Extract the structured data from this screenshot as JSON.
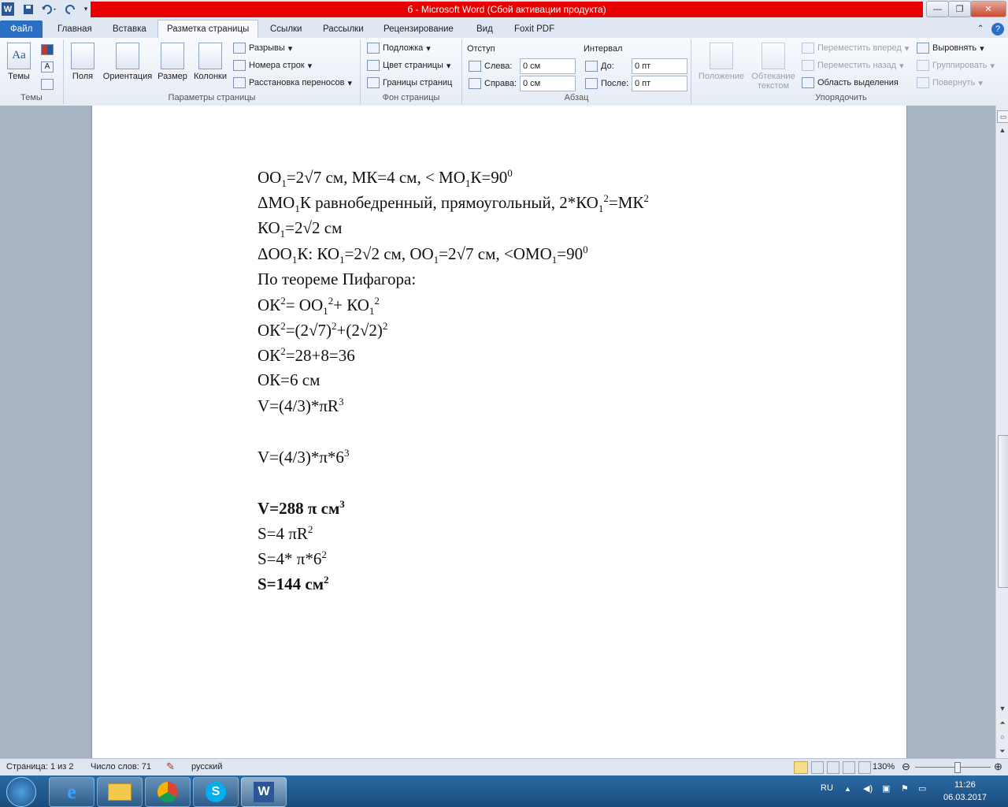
{
  "window": {
    "title": "б - Microsoft Word (Сбой активации продукта)",
    "word_icon": "W",
    "save_icon": "save-icon",
    "undo_icon": "undo-icon",
    "redo_icon": "redo-icon",
    "minimize": "—",
    "restore": "❐",
    "close": "✕"
  },
  "tabs": {
    "file": "Файл",
    "items": [
      "Главная",
      "Вставка",
      "Разметка страницы",
      "Ссылки",
      "Рассылки",
      "Рецензирование",
      "Вид",
      "Foxit PDF"
    ],
    "active_index": 2
  },
  "ribbon": {
    "themes": {
      "label": "Темы",
      "group": "Темы"
    },
    "page_setup": {
      "group": "Параметры страницы",
      "fields": "Поля",
      "orientation": "Ориентация",
      "size": "Размер",
      "columns": "Колонки",
      "breaks": "Разрывы",
      "line_numbers": "Номера строк",
      "hyphenation": "Расстановка переносов"
    },
    "page_background": {
      "group": "Фон страницы",
      "watermark": "Подложка",
      "page_color": "Цвет страницы",
      "page_borders": "Границы страниц"
    },
    "paragraph": {
      "group": "Абзац",
      "indent": "Отступ",
      "spacing": "Интервал",
      "left_label": "Слева:",
      "left_value": "0 см",
      "right_label": "Справа:",
      "right_value": "0 см",
      "before_label": "До:",
      "before_value": "0 пт",
      "after_label": "После:",
      "after_value": "0 пт"
    },
    "arrange": {
      "group": "Упорядочить",
      "position": "Положение",
      "wrap1": "Обтекание",
      "wrap2": "текстом",
      "bring_forward": "Переместить вперед",
      "send_backward": "Переместить назад",
      "selection_pane": "Область выделения",
      "align": "Выровнять",
      "group_btn": "Группировать",
      "rotate": "Повернуть"
    }
  },
  "document": {
    "lines": [
      {
        "parts": [
          [
            "OO"
          ],
          [
            "1",
            "sub"
          ],
          [
            "=2√7 см, МК=4 см, < МО"
          ],
          [
            "1",
            "sub"
          ],
          [
            "К=90"
          ],
          [
            "0",
            "sup"
          ]
        ]
      },
      {
        "parts": [
          [
            "ΔМО"
          ],
          [
            "1",
            "sub"
          ],
          [
            "К равнобедренный, прямоугольный, 2*КО"
          ],
          [
            "1",
            "sub"
          ],
          [
            "2",
            "sup"
          ],
          [
            "=МК"
          ],
          [
            "2",
            "sup"
          ]
        ]
      },
      {
        "parts": [
          [
            "КО"
          ],
          [
            "1",
            "sub"
          ],
          [
            "=2√2 см"
          ]
        ]
      },
      {
        "parts": [
          [
            "ΔОО"
          ],
          [
            "1",
            "sub"
          ],
          [
            "К: КО"
          ],
          [
            "1",
            "sub"
          ],
          [
            "=2√2 см, ОО"
          ],
          [
            "1",
            "sub"
          ],
          [
            "=2√7 см, <ОМО"
          ],
          [
            "1",
            "sub"
          ],
          [
            "=90"
          ],
          [
            "0",
            "sup"
          ]
        ]
      },
      {
        "parts": [
          [
            "По теореме Пифагора:"
          ]
        ]
      },
      {
        "parts": [
          [
            "ОК"
          ],
          [
            "2",
            "sup"
          ],
          [
            "= ОО"
          ],
          [
            "1",
            "sub"
          ],
          [
            "2",
            "sup"
          ],
          [
            "+ КО"
          ],
          [
            "1",
            "sub"
          ],
          [
            "2",
            "sup"
          ]
        ]
      },
      {
        "parts": [
          [
            "ОК"
          ],
          [
            "2",
            "sup"
          ],
          [
            "=(2√7)"
          ],
          [
            "2",
            "sup"
          ],
          [
            "+(2√2)"
          ],
          [
            "2",
            "sup"
          ]
        ]
      },
      {
        "parts": [
          [
            "ОК"
          ],
          [
            "2",
            "sup"
          ],
          [
            "=28+8=36"
          ]
        ]
      },
      {
        "parts": [
          [
            "ОК=6 см"
          ]
        ]
      },
      {
        "parts": [
          [
            "V=(4/3)*πR"
          ],
          [
            "3",
            "sup"
          ]
        ]
      },
      {
        "parts": [
          [
            "V=(4/3)*π*6"
          ],
          [
            "3",
            "sup"
          ]
        ]
      },
      {
        "parts": [
          [
            "V=288 π см"
          ],
          [
            "3",
            "sup"
          ]
        ],
        "bold": true
      },
      {
        "parts": [
          [
            "S=4 πR"
          ],
          [
            "2",
            "sup"
          ]
        ]
      },
      {
        "parts": [
          [
            "S=4* π*6"
          ],
          [
            "2",
            "sup"
          ]
        ]
      },
      {
        "parts": [
          [
            "S=144 см"
          ],
          [
            "2",
            "sup"
          ]
        ],
        "bold": true
      }
    ]
  },
  "status": {
    "page": "Страница: 1 из 2",
    "words": "Число слов: 71",
    "language": "русский",
    "zoom": "130%",
    "zoom_fraction": 0.5
  },
  "taskbar": {
    "apps": [
      "start-orb-icon",
      "ie-icon",
      "explorer-icon",
      "chrome-icon",
      "skype-icon",
      "word-icon"
    ],
    "lang": "RU",
    "time": "11:26",
    "date": "06.03.2017"
  }
}
